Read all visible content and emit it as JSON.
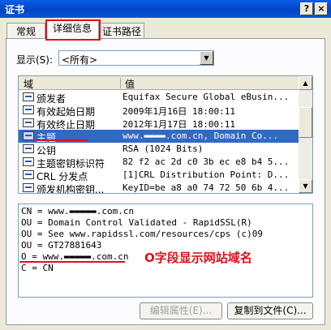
{
  "window": {
    "title": "证书",
    "help_label": "?",
    "close_label": "×"
  },
  "tabs": [
    {
      "label": "常规"
    },
    {
      "label": "详细信息"
    },
    {
      "label": "证书路径"
    }
  ],
  "show": {
    "label": "显示(S):",
    "selected": "<所有>"
  },
  "list": {
    "columns": [
      "域",
      "值"
    ],
    "rows": [
      {
        "field": "颁发者",
        "value": "Equifax Secure Global eBusin..."
      },
      {
        "field": "有效起始日期",
        "value": "2009年1月16日 18:00:11"
      },
      {
        "field": "有效终止日期",
        "value": "2012年1月17日 18:00:11"
      },
      {
        "field": "主题",
        "value": "www.▬▬▬▬.com.cn, Domain Co..."
      },
      {
        "field": "公钥",
        "value": "RSA (1024 Bits)"
      },
      {
        "field": "主题密钥标识符",
        "value": "82 f2 ac 2d c0 3b ec e8 b4 5..."
      },
      {
        "field": "CRL 分发点",
        "value": "[1]CRL Distribution Point: D..."
      },
      {
        "field": "颁发机构密钥...",
        "value": "KeyID=be a8 a0 74 72 50 6b 4..."
      }
    ]
  },
  "detail": {
    "lines": [
      "CN = www.▬▬▬▬▬.com.cn",
      "OU = Domain Control Validated - RapidSSL(R)",
      "OU = See www.rapidssl.com/resources/cps (c)09",
      "OU = GT27881643",
      "O = www.▬▬▬▬▬.com.cn",
      "C = CN"
    ]
  },
  "annotation": "O字段显示网站域名",
  "buttons": {
    "edit_props": "编辑属性(E)...",
    "copy_to_file": "复制到文件(C)..."
  },
  "colors": {
    "annotation_red": "#e0101c",
    "selection_blue": "#316ac5"
  }
}
